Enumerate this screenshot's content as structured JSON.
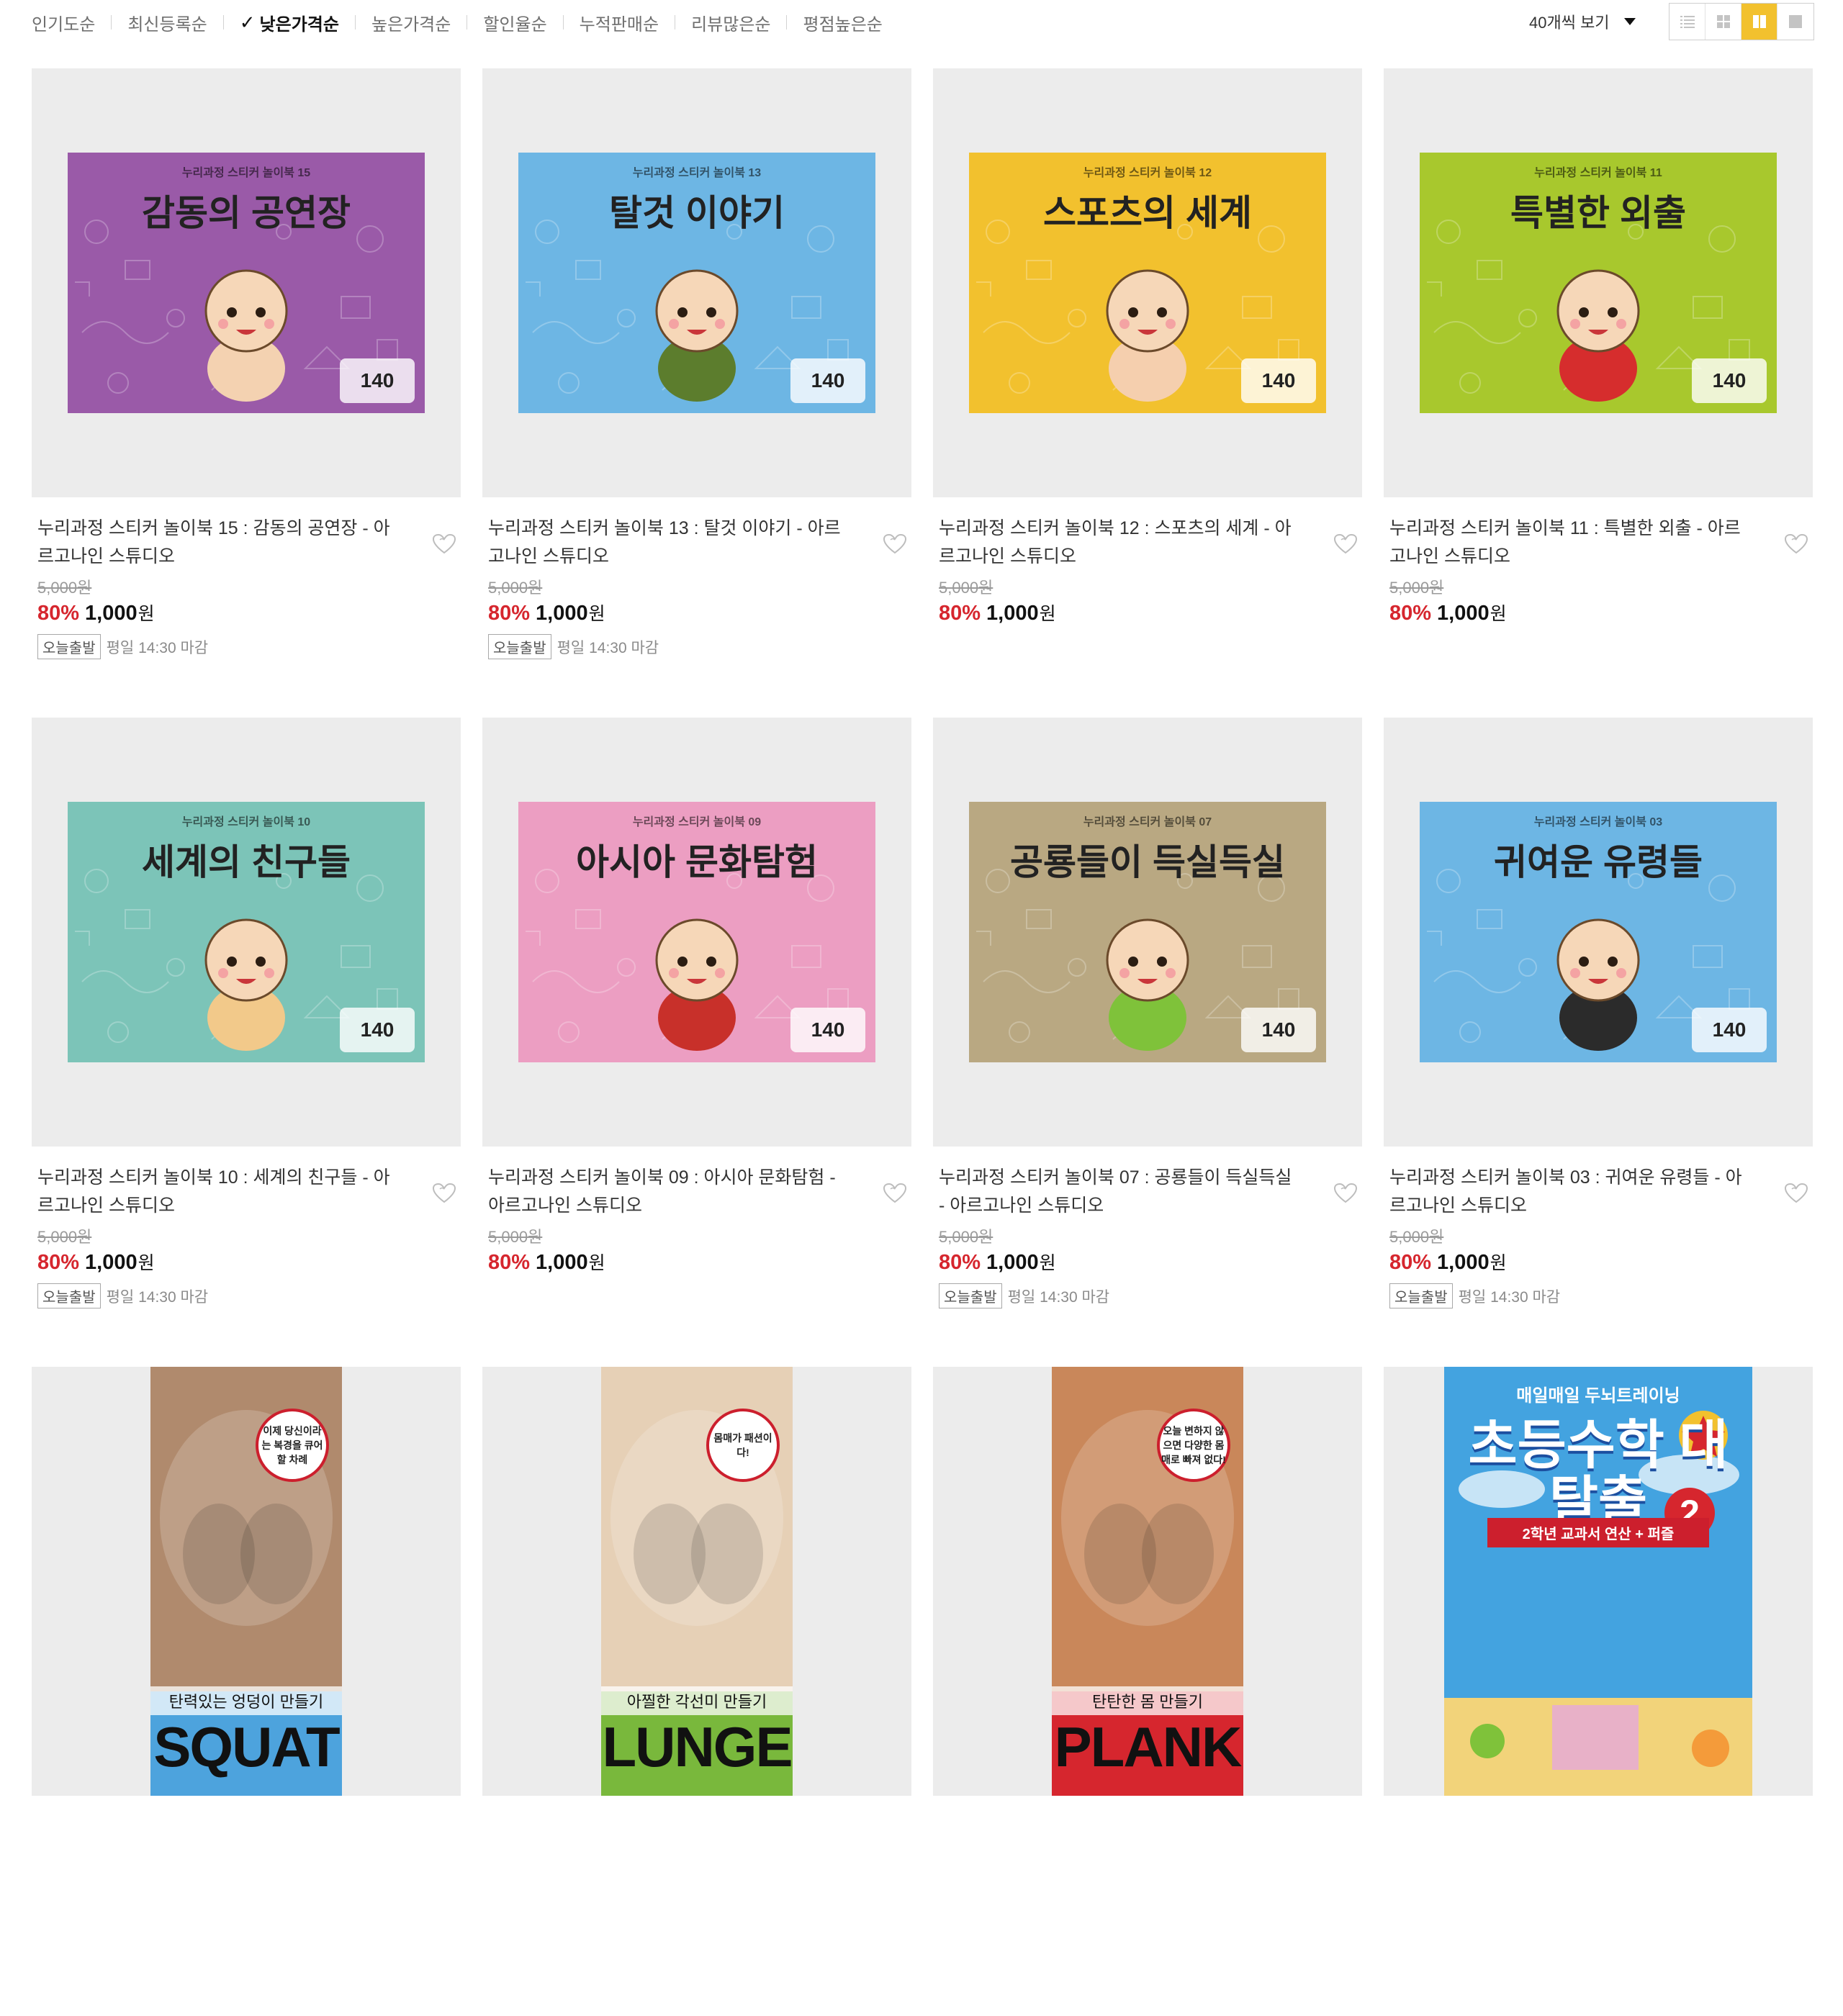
{
  "sort": {
    "items": [
      {
        "label": "인기도순",
        "active": false
      },
      {
        "label": "최신등록순",
        "active": false
      },
      {
        "label": "낮은가격순",
        "active": true
      },
      {
        "label": "높은가격순",
        "active": false
      },
      {
        "label": "할인율순",
        "active": false
      },
      {
        "label": "누적판매순",
        "active": false
      },
      {
        "label": "리뷰많은순",
        "active": false
      },
      {
        "label": "평점높은순",
        "active": false
      }
    ]
  },
  "view": {
    "count_label": "40개씩 보기",
    "modes": [
      "list-view-icon",
      "grid-4-view-icon",
      "grid-2-view-icon",
      "single-view-icon"
    ],
    "active_mode": 2
  },
  "colors": {
    "accent": "#f2c12e",
    "discount": "#d6262e"
  },
  "products": [
    {
      "title": "누리과정 스티커 놀이북 15 : 감동의 공연장 - 아르고나인 스튜디오",
      "original_price": "5,000원",
      "discount": "80%",
      "price": "1,000",
      "currency": "원",
      "shipping_badge": "오늘출발",
      "shipping_text": "평일 14:30 마감",
      "cover": {
        "kind": "sticker",
        "series": "누리과정 스티커 놀이북 15",
        "title": "감동의 공연장",
        "stamp": "140",
        "bg": "#9a5aa8",
        "figure": "#f4d2b1"
      }
    },
    {
      "title": "누리과정 스티커 놀이북 13 : 탈것 이야기 - 아르고나인 스튜디오",
      "original_price": "5,000원",
      "discount": "80%",
      "price": "1,000",
      "currency": "원",
      "shipping_badge": "오늘출발",
      "shipping_text": "평일 14:30 마감",
      "cover": {
        "kind": "sticker",
        "series": "누리과정 스티커 놀이북 13",
        "title": "탈것 이야기",
        "stamp": "140",
        "bg": "#6db6e4",
        "figure": "#5c7d2d"
      }
    },
    {
      "title": "누리과정 스티커 놀이북 12 : 스포츠의 세계 - 아르고나인 스튜디오",
      "original_price": "5,000원",
      "discount": "80%",
      "price": "1,000",
      "currency": "원",
      "shipping_badge": "",
      "shipping_text": "",
      "cover": {
        "kind": "sticker",
        "series": "누리과정 스티커 놀이북 12",
        "title": "스포츠의 세계",
        "stamp": "140",
        "bg": "#f2c12e",
        "figure": "#f5cfae"
      }
    },
    {
      "title": "누리과정 스티커 놀이북 11 : 특별한 외출 - 아르고나인 스튜디오",
      "original_price": "5,000원",
      "discount": "80%",
      "price": "1,000",
      "currency": "원",
      "shipping_badge": "",
      "shipping_text": "",
      "cover": {
        "kind": "sticker",
        "series": "누리과정 스티커 놀이북 11",
        "title": "특별한 외출",
        "stamp": "140",
        "bg": "#a8c82d",
        "figure": "#d62d2d"
      }
    },
    {
      "title": "누리과정 스티커 놀이북 10 : 세계의 친구들 - 아르고나인 스튜디오",
      "original_price": "5,000원",
      "discount": "80%",
      "price": "1,000",
      "currency": "원",
      "shipping_badge": "오늘출발",
      "shipping_text": "평일 14:30 마감",
      "cover": {
        "kind": "sticker",
        "series": "누리과정 스티커 놀이북 10",
        "title": "세계의 친구들",
        "stamp": "140",
        "bg": "#7cc4b8",
        "figure": "#f2c98a"
      }
    },
    {
      "title": "누리과정 스티커 놀이북 09 : 아시아 문화탐험 - 아르고나인 스튜디오",
      "original_price": "5,000원",
      "discount": "80%",
      "price": "1,000",
      "currency": "원",
      "shipping_badge": "",
      "shipping_text": "",
      "cover": {
        "kind": "sticker",
        "series": "누리과정 스티커 놀이북 09",
        "title": "아시아 문화탐험",
        "stamp": "140",
        "bg": "#ec9ec2",
        "figure": "#c8302a"
      }
    },
    {
      "title": "누리과정 스티커 놀이북 07 : 공룡들이 득실득실 - 아르고나인 스튜디오",
      "original_price": "5,000원",
      "discount": "80%",
      "price": "1,000",
      "currency": "원",
      "shipping_badge": "오늘출발",
      "shipping_text": "평일 14:30 마감",
      "cover": {
        "kind": "sticker",
        "series": "누리과정 스티커 놀이북 07",
        "title": "공룡들이 득실득실",
        "stamp": "140",
        "bg": "#b9a882",
        "figure": "#7fc23a"
      }
    },
    {
      "title": "누리과정 스티커 놀이북 03 : 귀여운 유령들 - 아르고나인 스튜디오",
      "original_price": "5,000원",
      "discount": "80%",
      "price": "1,000",
      "currency": "원",
      "shipping_badge": "오늘출발",
      "shipping_text": "평일 14:30 마감",
      "cover": {
        "kind": "sticker",
        "series": "누리과정 스티커 놀이북 03",
        "title": "귀여운 유령들",
        "stamp": "140",
        "bg": "#6db6e4",
        "figure": "#2b2b2b"
      }
    },
    {
      "cover": {
        "kind": "fitness",
        "badge": "이제 당신이라는 복경을 큐어할 차례",
        "sub": "탄력있는 엉덩이 만들기",
        "word": "SQUAT",
        "photo": "#b08a6d",
        "band": "#4da3dd"
      }
    },
    {
      "cover": {
        "kind": "fitness",
        "badge": "몸매가 패션이다!",
        "sub": "아찔한 각선미 만들기",
        "word": "LUNGE",
        "photo": "#e6d0b6",
        "band": "#79b83c"
      }
    },
    {
      "cover": {
        "kind": "fitness",
        "badge": "오늘 변하지 않으면 다양한 몸매로 빠져 없다!",
        "sub": "탄탄한 몸 만들기",
        "word": "PLANK",
        "photo": "#c9875a",
        "band": "#d6262e"
      }
    },
    {
      "cover": {
        "kind": "math",
        "top": "매일매일 두뇌트레이닝",
        "big": "초등수학 대탈출",
        "num": "2",
        "sub": "2학년 교과서 연산 + 퍼즐",
        "bg": "#43a3e0"
      }
    }
  ]
}
